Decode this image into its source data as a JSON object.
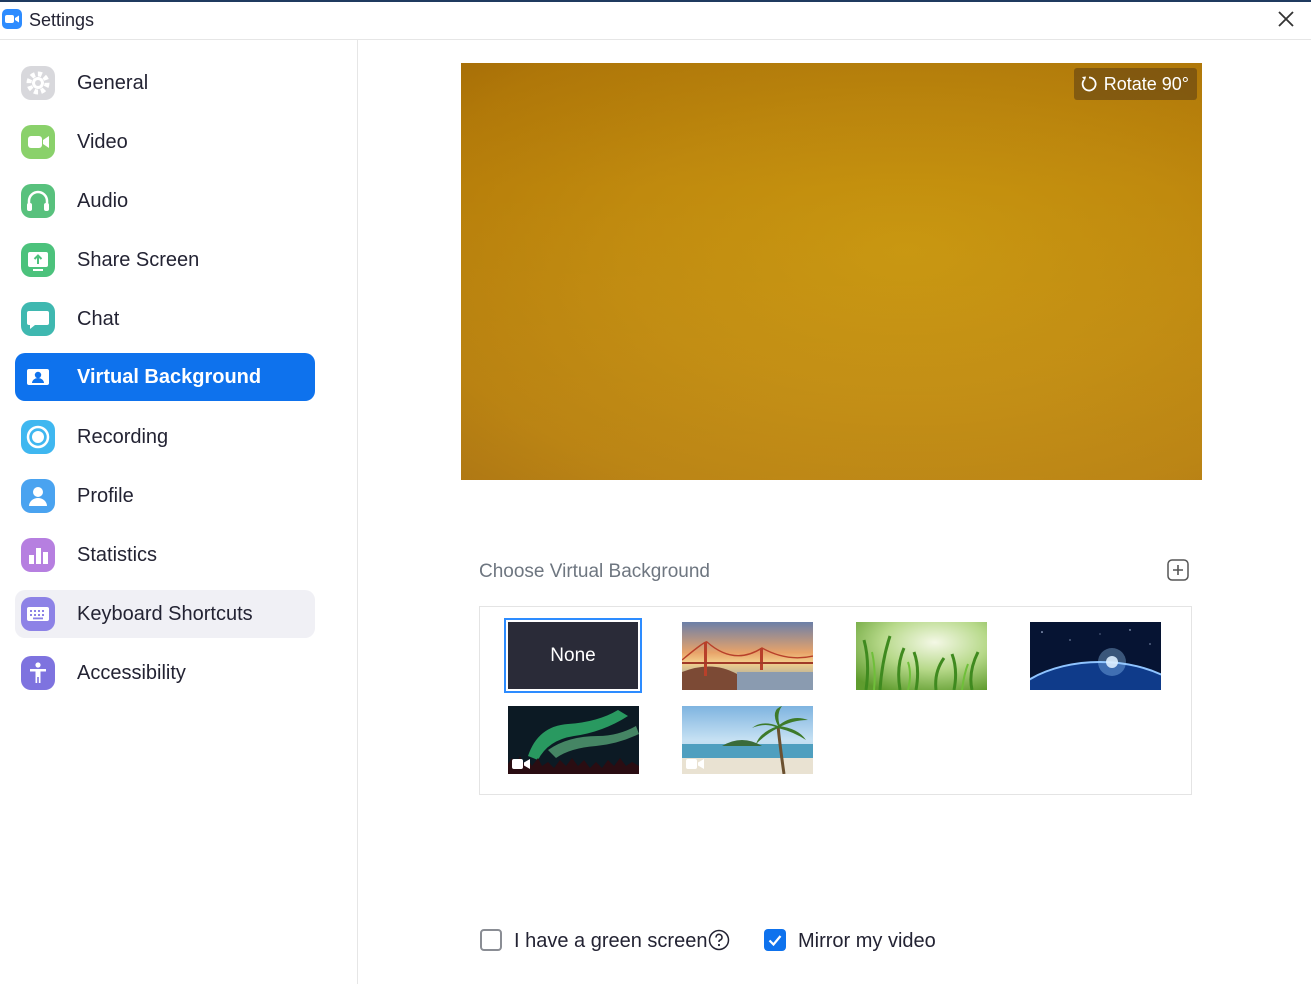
{
  "window": {
    "title": "Settings"
  },
  "sidebar": {
    "items": [
      {
        "label": "General",
        "icon": "gear-icon",
        "color": "#d8d8dc",
        "state": "normal"
      },
      {
        "label": "Video",
        "icon": "video-camera-icon",
        "color": "#8ad16b",
        "state": "normal"
      },
      {
        "label": "Audio",
        "icon": "headphones-icon",
        "color": "#58c17d",
        "state": "normal"
      },
      {
        "label": "Share Screen",
        "icon": "share-screen-icon",
        "color": "#4cc27c",
        "state": "normal"
      },
      {
        "label": "Chat",
        "icon": "chat-bubble-icon",
        "color": "#3fb8b0",
        "state": "normal"
      },
      {
        "label": "Virtual Background",
        "icon": "person-card-icon",
        "color": "#0e72ed",
        "state": "active"
      },
      {
        "label": "Recording",
        "icon": "record-icon",
        "color": "#3fb7f0",
        "state": "normal"
      },
      {
        "label": "Profile",
        "icon": "profile-icon",
        "color": "#4aa3f0",
        "state": "normal"
      },
      {
        "label": "Statistics",
        "icon": "bar-chart-icon",
        "color": "#b67fe0",
        "state": "normal"
      },
      {
        "label": "Keyboard Shortcuts",
        "icon": "keyboard-icon",
        "color": "#8d82e6",
        "state": "hover"
      },
      {
        "label": "Accessibility",
        "icon": "accessibility-icon",
        "color": "#7e73df",
        "state": "normal"
      }
    ]
  },
  "preview": {
    "rotate_label": "Rotate 90°"
  },
  "backgrounds": {
    "title": "Choose Virtual Background",
    "none_label": "None",
    "items": [
      {
        "name": "golden-gate-bridge",
        "video": false
      },
      {
        "name": "green-grass",
        "video": false
      },
      {
        "name": "earth-from-space",
        "video": false
      },
      {
        "name": "aurora-borealis",
        "video": true
      },
      {
        "name": "palm-beach",
        "video": true
      }
    ]
  },
  "options": {
    "green_screen_label": "I have a green screen",
    "green_screen_checked": false,
    "mirror_label": "Mirror my video",
    "mirror_checked": true
  },
  "colors": {
    "accent": "#0e72ed",
    "selection_border": "#2d8cff"
  }
}
